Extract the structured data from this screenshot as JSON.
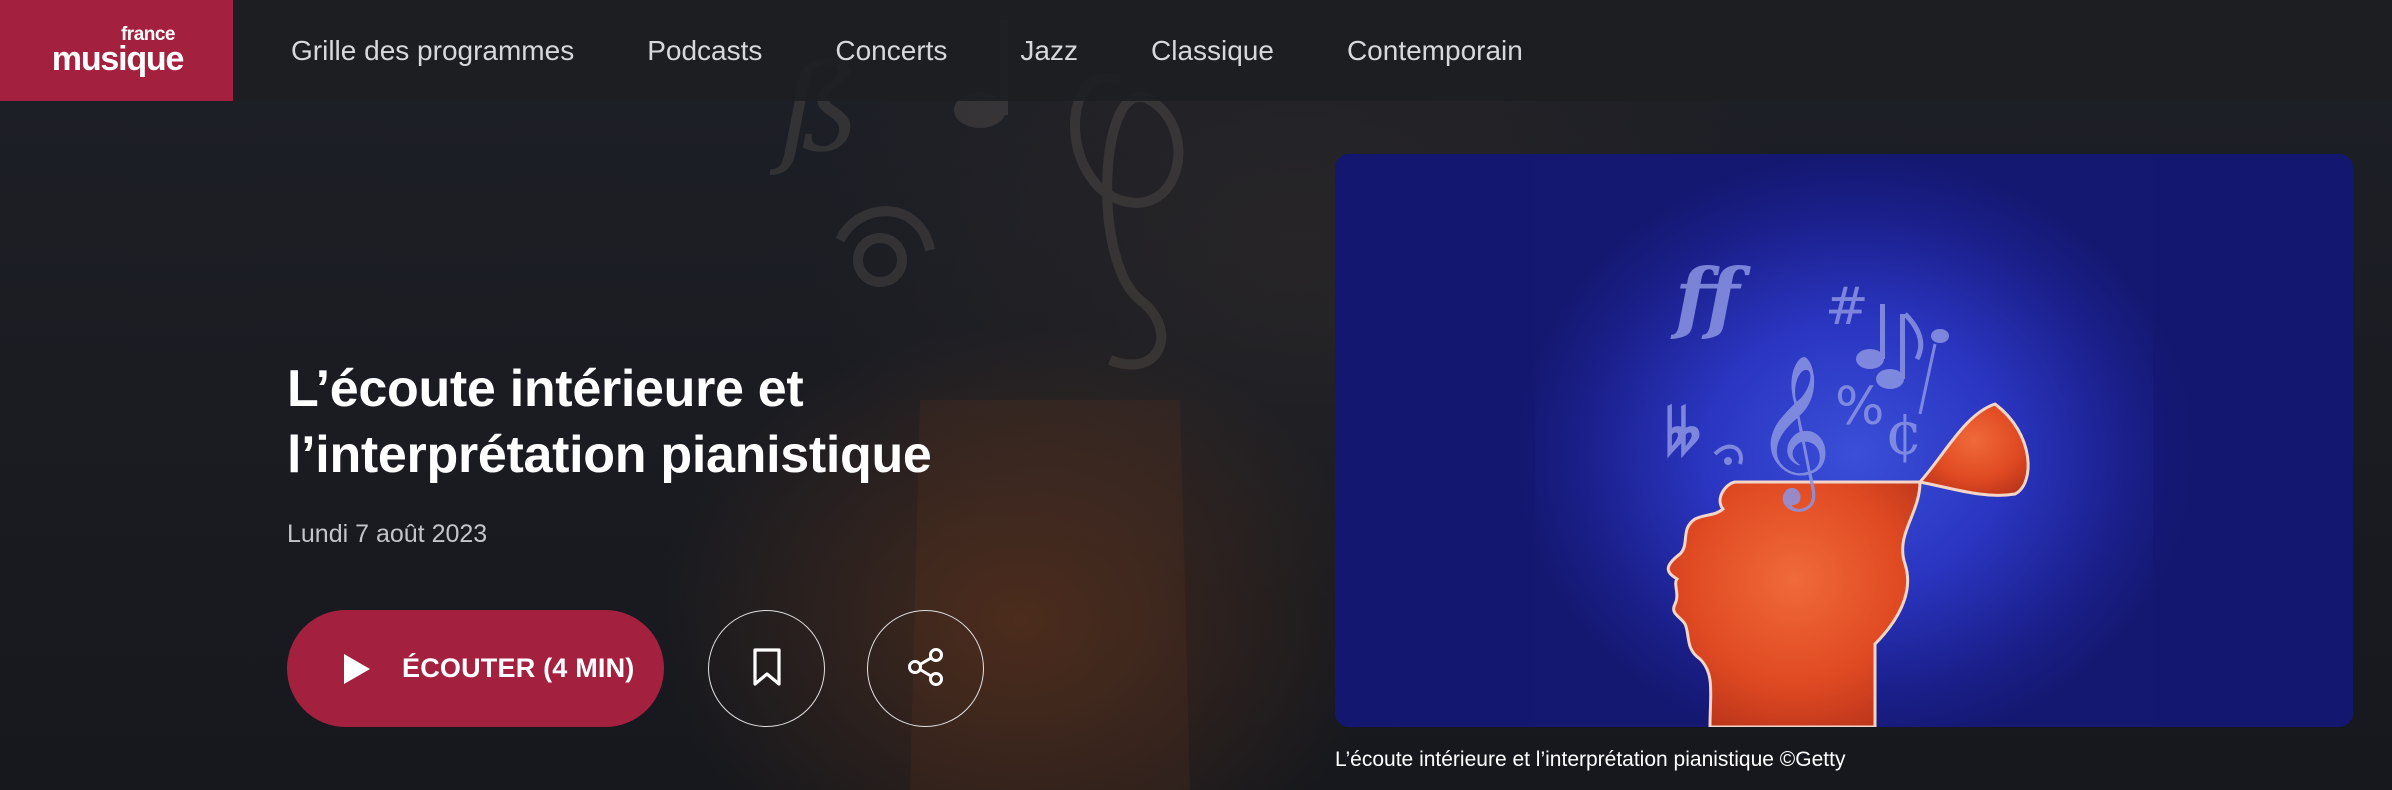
{
  "header": {
    "logo": {
      "top": "france",
      "bottom": "musique"
    },
    "nav": [
      "Grille des programmes",
      "Podcasts",
      "Concerts",
      "Jazz",
      "Classique",
      "Contemporain"
    ]
  },
  "episode": {
    "title_line1": "L’écoute intérieure et",
    "title_line2": "l’interprétation pianistique",
    "date": "Lundi 7 août 2023",
    "listen_label": "ÉCOUTER (4 MIN)",
    "image_caption": "L’écoute intérieure et l’interprétation pianistique ©Getty"
  },
  "icons": {
    "play": "play-icon",
    "bookmark": "bookmark-icon",
    "share": "share-icon"
  },
  "colors": {
    "brand": "#a3213f",
    "background": "#1b1d23",
    "image_blue": "#2a35c0",
    "head_orange": "#e04a22"
  }
}
